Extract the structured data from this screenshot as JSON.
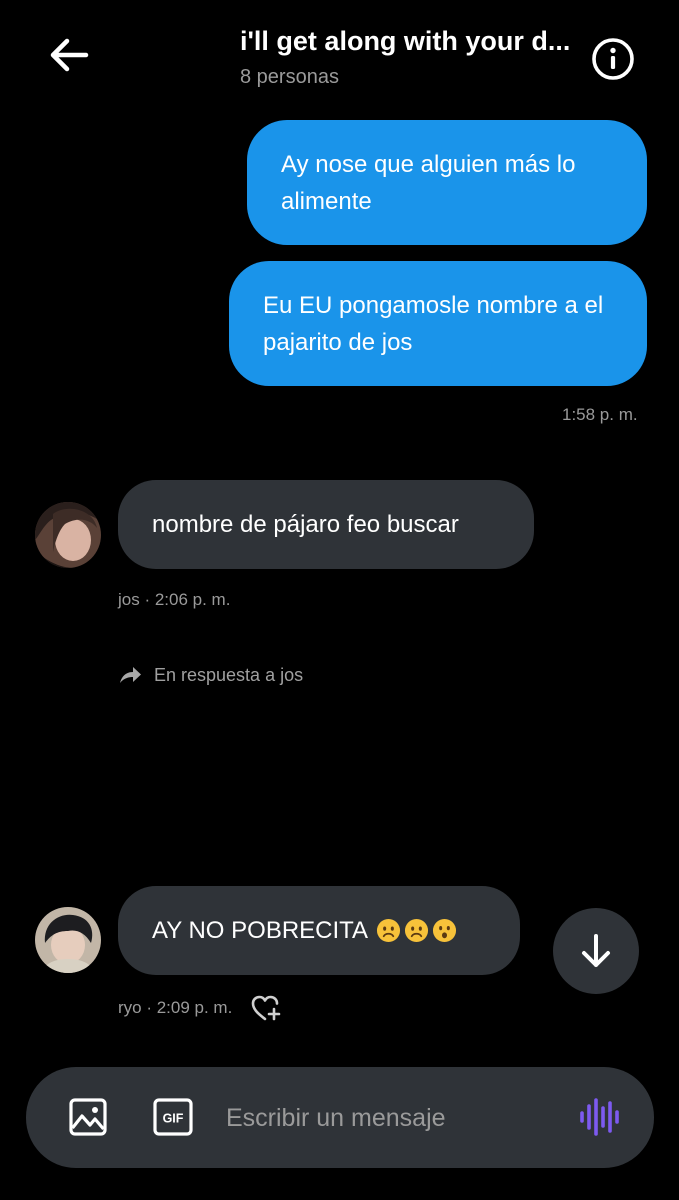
{
  "header": {
    "title": "i'll get along with your d...",
    "subtitle": "8 personas"
  },
  "messages": [
    {
      "text": "Ay nose que alguien más lo alimente"
    },
    {
      "text": "Eu EU pongamosle nombre a el pajarito de jos",
      "time": "1:58 p. m."
    },
    {
      "text": "nombre de pájaro feo buscar",
      "meta": "jos · 2:06 p. m."
    },
    {
      "reply_label": "En respuesta a jos"
    },
    {
      "text": "AY NO POBRECITA",
      "emojis": [
        "frowning-face-emoji",
        "frowning-face-emoji",
        "surprised-face-emoji"
      ],
      "meta": "ryo · 2:09 p. m."
    }
  ],
  "composer": {
    "placeholder": "Escribir un mensaje",
    "gif_label": "GIF"
  },
  "colors": {
    "background": "#000000",
    "outgoing_bubble": "#1a94ea",
    "incoming_bubble": "#2f3338",
    "secondary_text": "#9a9a9a",
    "voice_accent": "#7d5af0"
  }
}
